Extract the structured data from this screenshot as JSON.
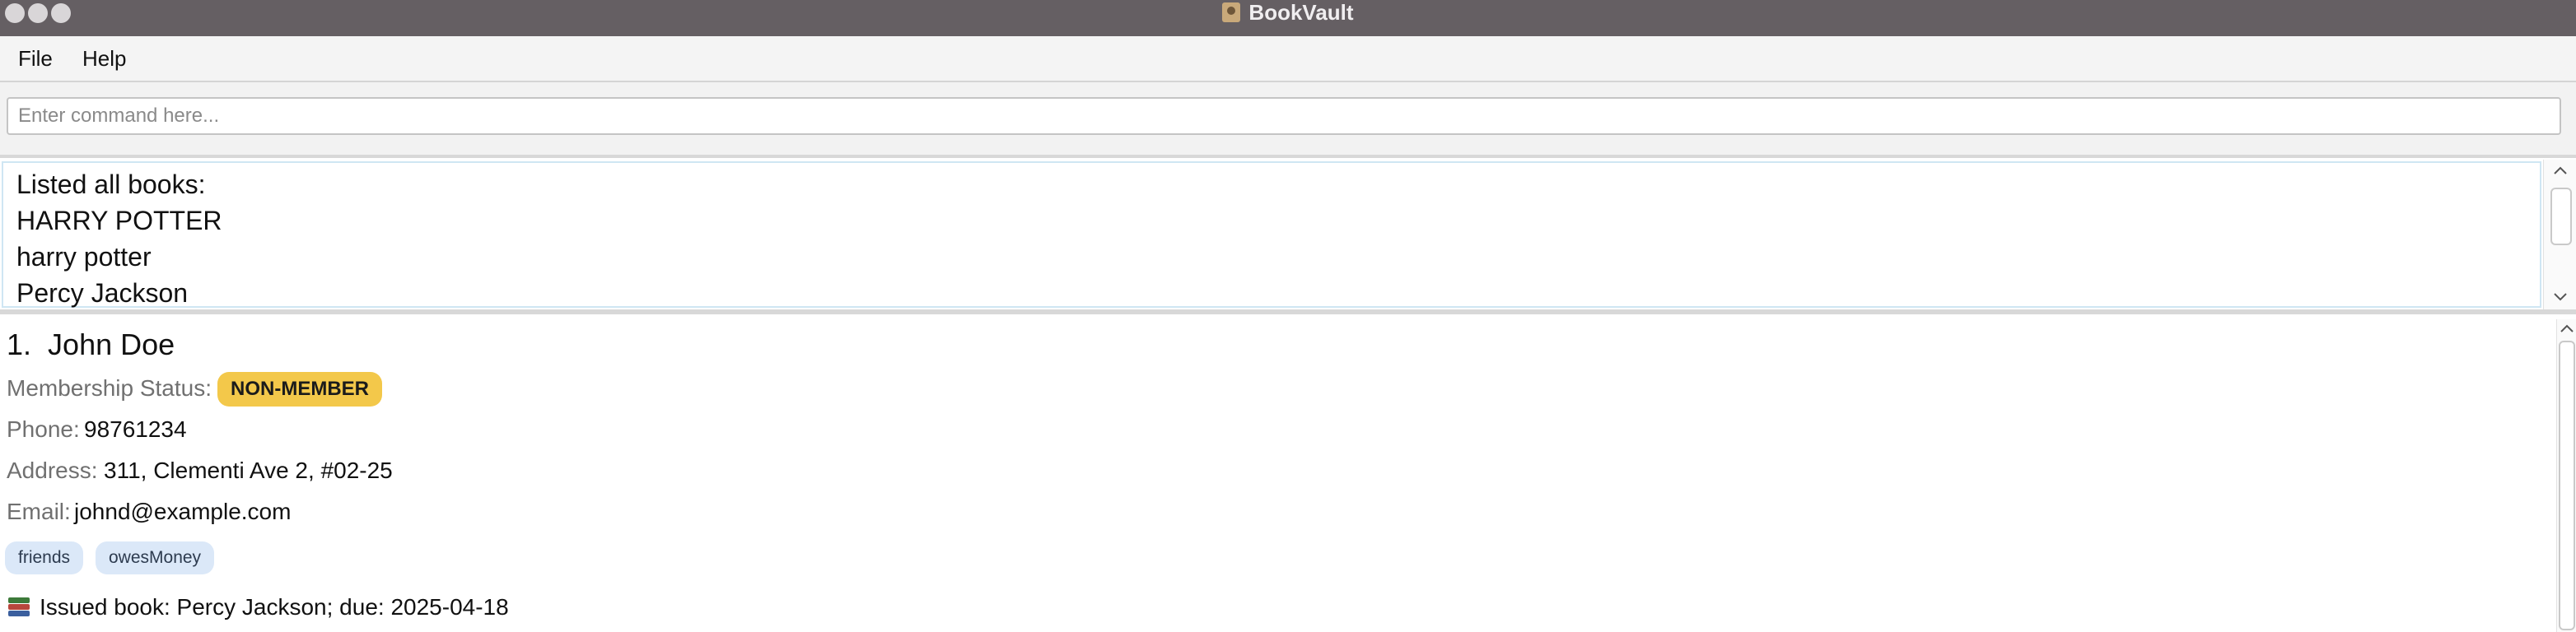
{
  "window": {
    "title": "BookVault"
  },
  "menu": {
    "items": [
      "File",
      "Help"
    ]
  },
  "command": {
    "placeholder": "Enter command here...",
    "value": ""
  },
  "result": {
    "lines": [
      "Listed all books:",
      "HARRY POTTER",
      "harry potter",
      "Percy Jackson"
    ]
  },
  "persons": [
    {
      "index": "1.",
      "name": "John Doe",
      "membership_label": "Membership Status:",
      "membership_value": "NON-MEMBER",
      "phone_label": "Phone:",
      "phone": "98761234",
      "address_label": "Address:",
      "address": "311, Clementi Ave 2, #02-25",
      "email_label": "Email:",
      "email": "johnd@example.com",
      "tags": [
        "friends",
        "owesMoney"
      ],
      "issued_text": "Issued book: Percy Jackson; due: 2025-04-18"
    }
  ],
  "icons": {
    "app": "app-icon",
    "issued": "books-icon"
  },
  "colors": {
    "titlebar": "#655f63",
    "badge": "#f3c84a",
    "tag": "#dbe8f8"
  }
}
